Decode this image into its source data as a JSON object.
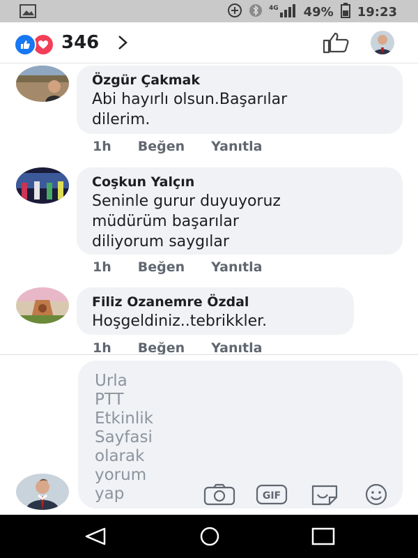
{
  "status_bar": {
    "battery": "49%",
    "time": "19:23",
    "network": "4G"
  },
  "header": {
    "reaction_count": "346",
    "icons": [
      "like-reaction-icon",
      "love-reaction-icon",
      "chevron-right-icon",
      "thumbs-up-icon"
    ]
  },
  "comments": [
    {
      "author": "Özgür Çakmak",
      "lines": [
        "Abi hayırlı olsun.Başarılar",
        "dilerim."
      ],
      "time": "1h",
      "like_label": "Beğen",
      "reply_label": "Yanıtla"
    },
    {
      "author": "Coşkun Yalçın",
      "lines": [
        "Seninle gurur duyuyoruz",
        "müdürüm başarılar",
        "diliyorum saygılar"
      ],
      "time": "1h",
      "like_label": "Beğen",
      "reply_label": "Yanıtla"
    },
    {
      "author": "Filiz Ozanemre Özdal",
      "lines": [
        "Hoşgeldiniz..tebrikkler."
      ],
      "time": "1h",
      "like_label": "Beğen",
      "reply_label": "Yanıtla"
    }
  ],
  "composer": {
    "placeholder_lines": [
      "Urla",
      "PTT",
      "Etkinlik",
      "Sayfasi",
      "olarak",
      "yorum",
      "yap"
    ],
    "gif_label": "GIF",
    "icons": [
      "camera-icon",
      "gif-icon",
      "sticker-icon",
      "emoji-icon"
    ]
  },
  "nav": {
    "icons": [
      "back-icon",
      "home-icon",
      "recents-icon"
    ]
  },
  "colors": {
    "accent": "#1877f2",
    "love": "#f33e58",
    "bubble": "#f0f2f5",
    "secondary_text": "#606770"
  }
}
